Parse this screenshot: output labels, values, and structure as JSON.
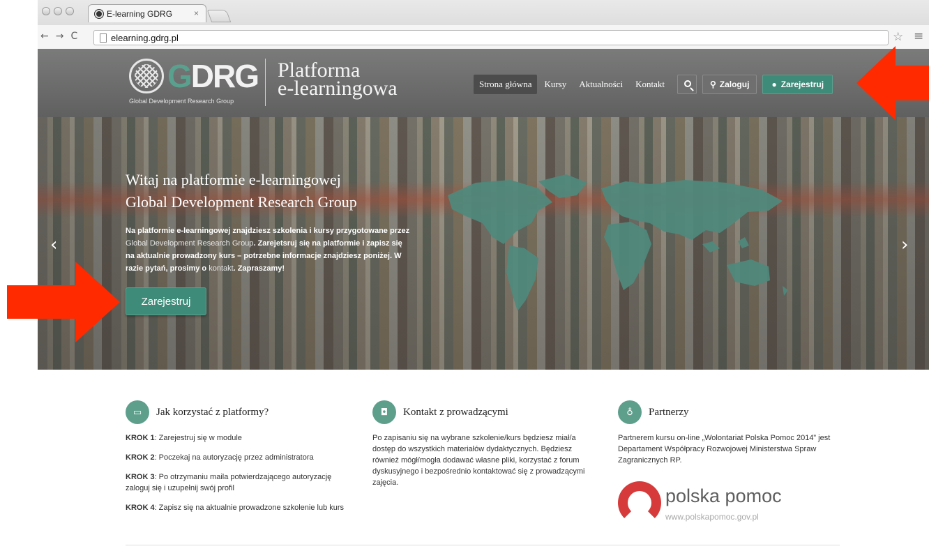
{
  "browser": {
    "tab_title": "E-learning GDRG",
    "tab_close": "×",
    "url": "elearning.gdrg.pl",
    "back": "←",
    "forward": "→",
    "reload": "C"
  },
  "header": {
    "logo_letter_g": "G",
    "logo_letters_rest": "DRG",
    "logo_subtitle": "Global Development Research Group",
    "platform_line1": "Platforma",
    "platform_line2": "e-learningowa",
    "nav": [
      {
        "label": "Strona główna",
        "active": true
      },
      {
        "label": "Kursy",
        "active": false
      },
      {
        "label": "Aktualności",
        "active": false
      },
      {
        "label": "Kontakt",
        "active": false
      }
    ],
    "login_label": "Zaloguj",
    "register_label": "Zarejestruj"
  },
  "hero": {
    "title_line1": "Witaj na platformie e-learningowej",
    "title_line2": "Global Development Research Group",
    "text_part1": "Na platformie e-learningowej znajdziesz szkolenia i kursy przygotowane przez ",
    "text_link1": "Global Development Research Group",
    "text_part2": ". Zarejetsruj się na platformie i zapisz się na aktualnie prowadzony kurs – potrzebne informacje znajdziesz poniżej. W razie pytań, prosimy o ",
    "text_link2": "kontakt",
    "text_part3": ". Zapraszamy!",
    "button_label": "Zarejestruj",
    "prev_arrow": "‹",
    "next_arrow": "›"
  },
  "features": {
    "how_to": {
      "title": "Jak korzystać z platformy?",
      "steps": [
        {
          "label": "KROK 1",
          "text": ": Zarejestruj się w module"
        },
        {
          "label": "KROK 2",
          "text": ": Poczekaj na autoryzację przez administratora"
        },
        {
          "label": "KROK 3",
          "text": ": Po otrzymaniu maila potwierdzającego autoryzację zaloguj się i uzupełnij swój profil"
        },
        {
          "label": "KROK 4",
          "text": ": Zapisz się na aktualnie prowadzone szkolenie lub kurs"
        }
      ]
    },
    "contact": {
      "title": "Kontakt z prowadzącymi",
      "body": "Po zapisaniu się na wybrane szkolenie/kurs będziesz miał/a dostęp do wszystkich materiałów dydaktycznych. Będziesz również mógł/mogła dodawać własne pliki, korzystać z forum dyskusyjnego i bezpośrednio kontaktować się z prowadzącymi zajęcia."
    },
    "partners": {
      "title": "Partnerzy",
      "body": "Partnerem kursu on-line „Wolontariat Polska Pomoc 2014” jest Departament Współpracy Rozwojowej Ministerstwa Spraw Zagranicznych RP.",
      "logo_text": "polska pomoc",
      "logo_url": "www.polskapomoc.gov.pl"
    }
  },
  "colors": {
    "accent_green": "#3f8b79",
    "icon_green": "#5e9f8c",
    "header_gray": "#6e6f6e",
    "annotation_red": "#ff2a00",
    "polska_pomoc_red": "#d63a3a"
  }
}
